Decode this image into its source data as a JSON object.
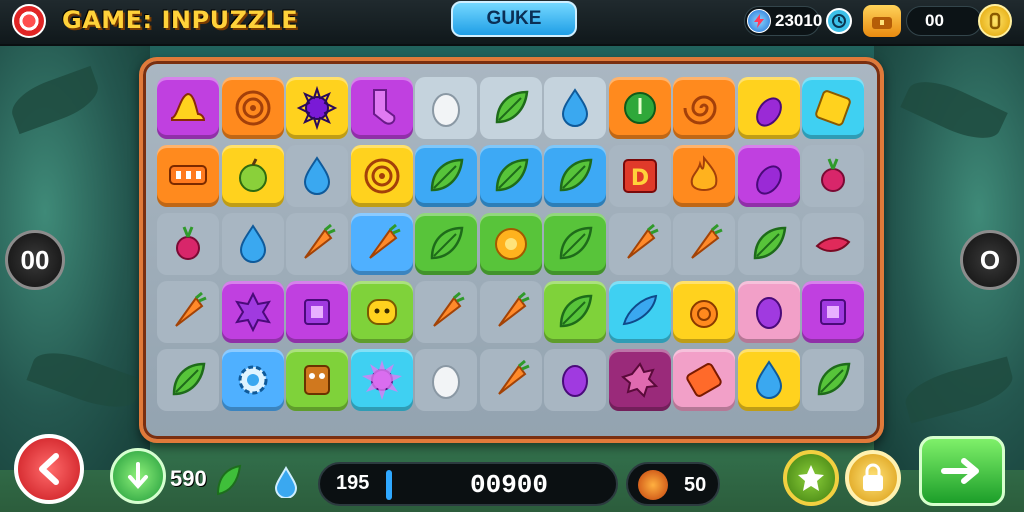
{
  "header": {
    "title": "GAME: INPUZZLE",
    "mode_button": "GUKE",
    "energy_value": "23010",
    "coins_value": "00"
  },
  "side": {
    "left_label": "00",
    "right_label": "O"
  },
  "footer": {
    "moves_value": "590",
    "level_value": "195",
    "score_value": "00900",
    "fruit_value": "50"
  },
  "board": {
    "rows": 5,
    "cols": 11,
    "tiles": [
      [
        "purple-square",
        "orange-square",
        "yellow-square",
        "purple-square",
        "empty-light",
        "empty-light",
        "empty-light",
        "orange-square",
        "orange-square",
        "yellow-square",
        "cyan-square"
      ],
      [
        "orange-square",
        "yellow-square",
        "empty",
        "yellow-square",
        "blue-highlight",
        "blue-highlight",
        "blue-highlight",
        "empty",
        "orange-square",
        "purple-square",
        "empty"
      ],
      [
        "empty",
        "empty",
        "empty",
        "blue-square",
        "green-highlight",
        "green-highlight",
        "green-highlight",
        "empty",
        "empty",
        "empty",
        "empty"
      ],
      [
        "empty",
        "purple-square",
        "purple-square",
        "green-square",
        "empty",
        "empty",
        "green-square",
        "cyan-square",
        "yellow-square",
        "pink-square",
        "purple-square"
      ],
      [
        "empty",
        "blue-square",
        "green-square",
        "cyan-square",
        "empty",
        "empty",
        "empty",
        "purple-dark-square",
        "pink-square",
        "yellow-square",
        "empty"
      ]
    ],
    "icons": [
      [
        "hat-icon",
        "target-icon",
        "gear-star-icon",
        "sock-icon",
        "egg-icon",
        "leaf-icon",
        "drop-icon",
        "disc-icon",
        "spiral-icon",
        "eggplant-icon",
        "crate-icon"
      ],
      [
        "slot-icon",
        "apple-icon",
        "drop-icon",
        "target-icon",
        "leaf-icon",
        "leaf-icon",
        "leaf-icon",
        "letter-d-icon",
        "flame-icon",
        "eggplant-icon",
        "radish-icon"
      ],
      [
        "radish-icon",
        "drop-icon",
        "carrot-icon",
        "carrot-icon",
        "leaf-icon",
        "ring-icon",
        "leaf-icon",
        "carrot-icon",
        "carrot-icon",
        "leaf-icon",
        "chili-icon"
      ],
      [
        "carrot-icon",
        "spiky-icon",
        "chip-icon",
        "face-icon",
        "carrot-icon",
        "carrot-icon",
        "leaf-icon",
        "feather-icon",
        "alarm-icon",
        "plum-icon",
        "chip-icon"
      ],
      [
        "leaf-icon",
        "gear-icon",
        "robot-icon",
        "sunburst-icon",
        "egg-icon",
        "carrot-icon",
        "plum-icon",
        "cog-flower-icon",
        "tag-icon",
        "drop-icon",
        "leaf-icon"
      ]
    ],
    "colors": {
      "purple-square": "#c040e0",
      "orange-square": "#ff8a1e",
      "yellow-square": "#ffd21e",
      "cyan-square": "#3fd0f2",
      "blue-square": "#4fb0ff",
      "green-square": "#7fd23a",
      "pink-square": "#f2a0c8",
      "purple-dark-square": "#9a2a7a",
      "blue-highlight": "#3da9f5",
      "green-highlight": "#58c43a",
      "empty": "#a8b6c2",
      "empty-light": "#c5d3dd"
    }
  }
}
